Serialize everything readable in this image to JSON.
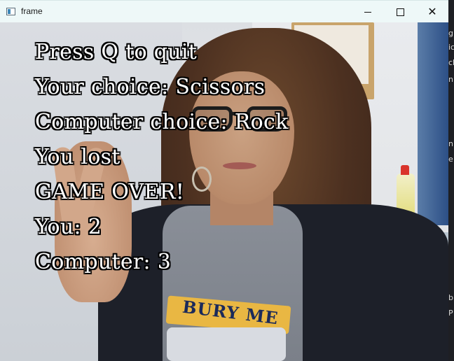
{
  "window": {
    "title": "frame",
    "controls": {
      "minimize": "minimize",
      "maximize": "maximize",
      "close": "✕"
    }
  },
  "overlay": {
    "lines": [
      "Press Q to quit",
      "Your choice: Scissors",
      "Computer choice: Rock",
      "You lost",
      "GAME OVER!",
      "You: 2",
      "Computer: 3"
    ]
  },
  "shirt_print": "BURY ME",
  "background_window": {
    "fragments": [
      "g",
      "ic",
      "ch",
      "n",
      "n",
      "e",
      "b",
      "P"
    ]
  },
  "colors": {
    "overlay_text": "#ffffff",
    "overlay_outline": "#000000",
    "titlebar": "#eef8f8"
  },
  "icons": [
    "app-icon",
    "minimize-icon",
    "maximize-icon",
    "close-icon"
  ]
}
